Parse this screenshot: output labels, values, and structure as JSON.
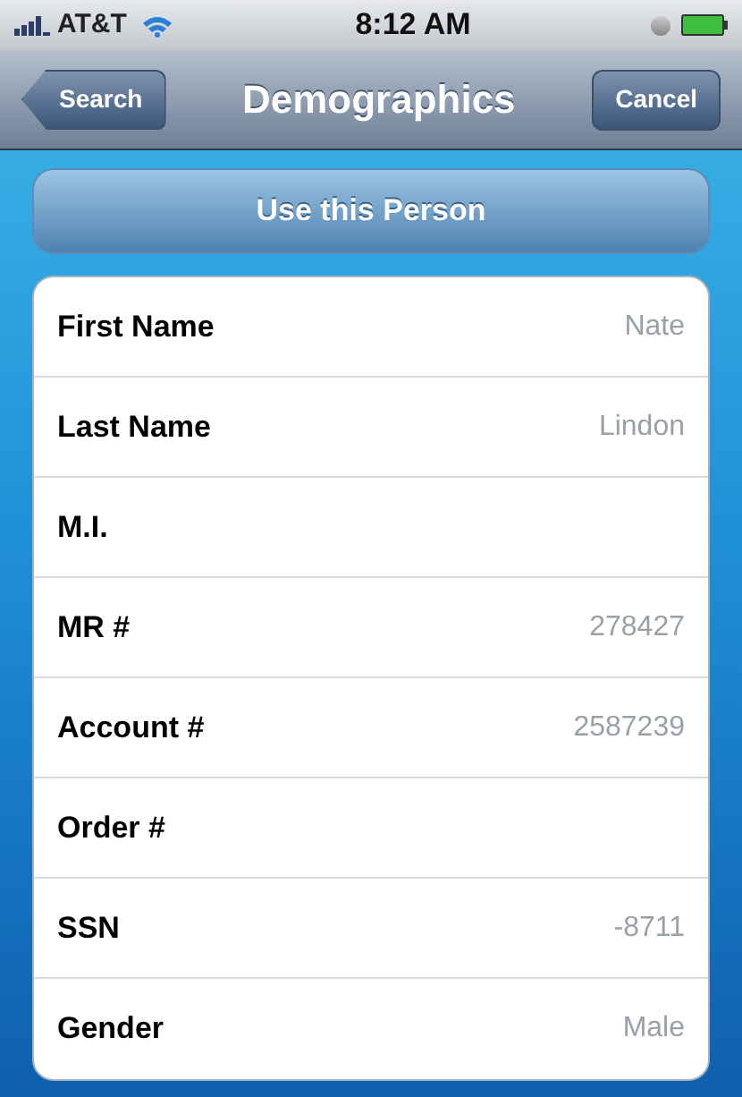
{
  "status_bar": {
    "carrier": "AT&T",
    "time": "8:12 AM"
  },
  "nav_bar": {
    "back_button": "Search",
    "title": "Demographics",
    "right_button": "Cancel"
  },
  "action_button": "Use this Person",
  "fields": [
    {
      "label": "First Name",
      "value": "Nate"
    },
    {
      "label": "Last Name",
      "value": "Lindon"
    },
    {
      "label": "M.I."
    },
    {
      "label": "MR #",
      "value": "278427"
    },
    {
      "label": "Account #",
      "value": "2587239"
    },
    {
      "label": "Order #"
    },
    {
      "label": "SSN",
      "value": "-8711"
    },
    {
      "label": "Gender",
      "value": "Male"
    }
  ]
}
